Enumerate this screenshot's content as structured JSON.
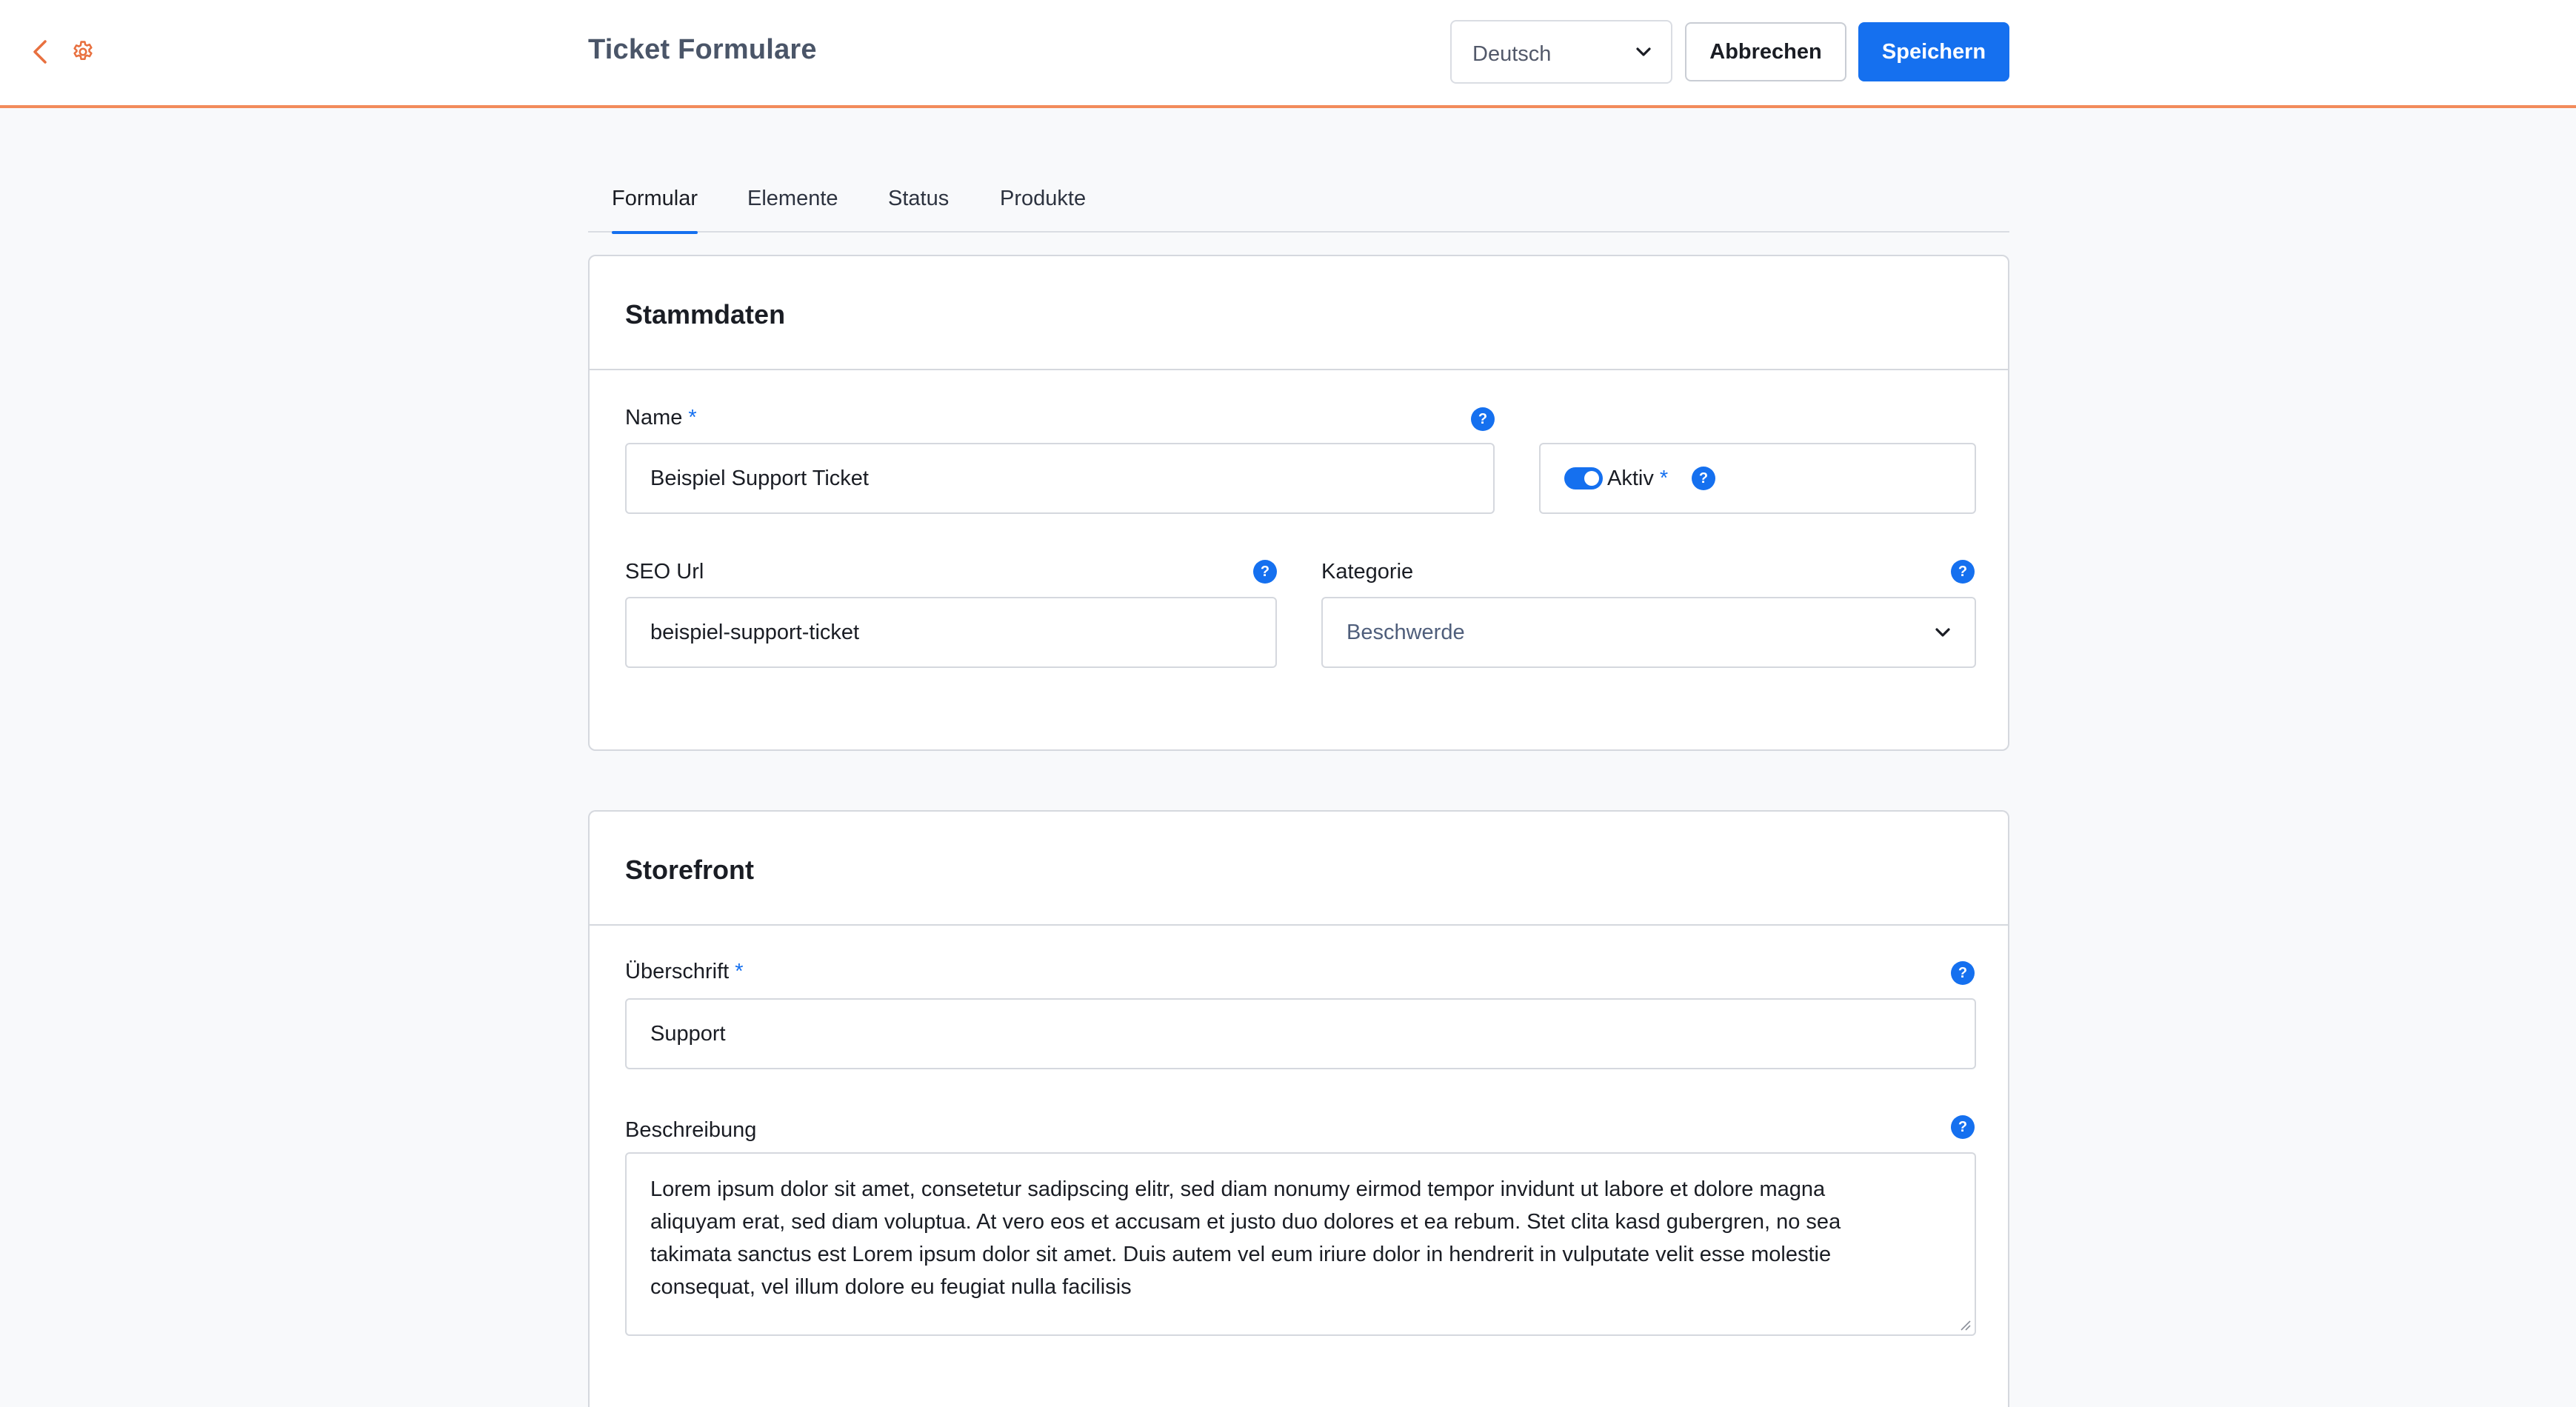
{
  "header": {
    "title": "Ticket Formulare",
    "language": "Deutsch",
    "cancel_label": "Abbrechen",
    "save_label": "Speichern"
  },
  "tabs": [
    {
      "label": "Formular",
      "active": true
    },
    {
      "label": "Elemente",
      "active": false
    },
    {
      "label": "Status",
      "active": false
    },
    {
      "label": "Produkte",
      "active": false
    }
  ],
  "stammdaten": {
    "title": "Stammdaten",
    "name_label": "Name",
    "name_value": "Beispiel Support Ticket",
    "active_label": "Aktiv",
    "active_value": true,
    "seo_label": "SEO Url",
    "seo_value": "beispiel-support-ticket",
    "category_label": "Kategorie",
    "category_value": "Beschwerde"
  },
  "storefront": {
    "title": "Storefront",
    "heading_label": "Überschrift",
    "heading_value": "Support",
    "description_label": "Beschreibung",
    "description_lines": [
      "Lorem ipsum dolor sit amet, consetetur sadipscing elitr, sed diam nonumy eirmod tempor invidunt ut labore et dolore magna",
      "aliquyam erat, sed diam voluptua. At vero eos et accusam et justo duo dolores et ea rebum. Stet clita kasd gubergren, no sea",
      "takimata sanctus est Lorem ipsum dolor sit amet. Duis autem vel eum iriure dolor in hendrerit in vulputate velit esse molestie",
      "consequat, vel illum dolore eu feugiat nulla facilisis"
    ]
  },
  "common": {
    "required_mark": "*",
    "help_glyph": "?"
  },
  "colors": {
    "accent": "#1570ef",
    "header_border": "#f28b5b",
    "icon_orange": "#e8703f"
  }
}
